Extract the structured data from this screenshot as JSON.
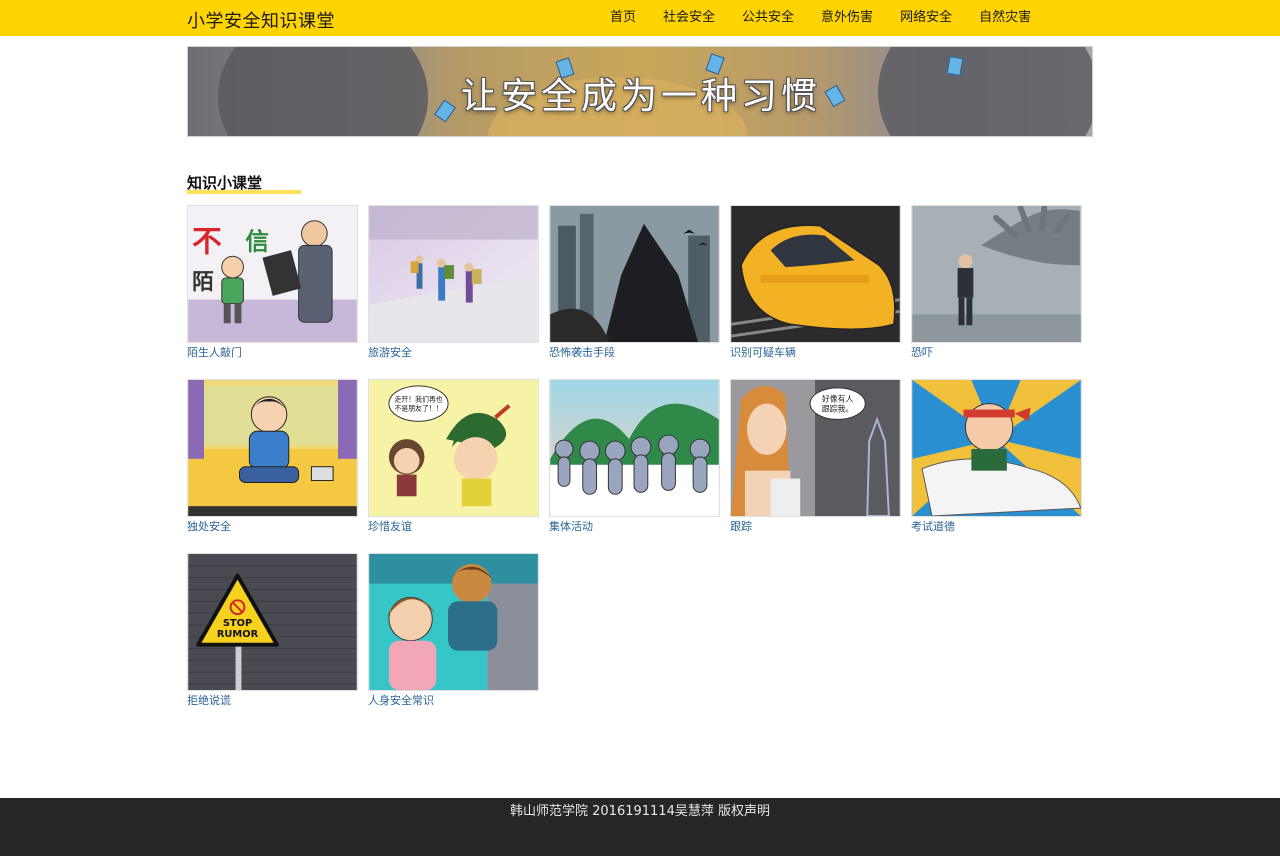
{
  "header": {
    "site_title": "小学安全知识课堂",
    "nav": [
      {
        "label": "首页"
      },
      {
        "label": "社会安全"
      },
      {
        "label": "公共安全"
      },
      {
        "label": "意外伤害"
      },
      {
        "label": "网络安全"
      },
      {
        "label": "自然灾害"
      }
    ]
  },
  "banner": {
    "slogan": "让安全成为一种习惯"
  },
  "section": {
    "title": "知识小课堂"
  },
  "items": [
    {
      "caption": "陌生人敲门"
    },
    {
      "caption": "旅游安全"
    },
    {
      "caption": "恐怖袭击手段"
    },
    {
      "caption": "识别可疑车辆"
    },
    {
      "caption": "恐吓"
    },
    {
      "caption": "独处安全"
    },
    {
      "caption": "珍惜友谊"
    },
    {
      "caption": "集体活动"
    },
    {
      "caption": "跟踪"
    },
    {
      "caption": "考试道德"
    },
    {
      "caption": "拒绝说谎"
    },
    {
      "caption": "人身安全常识"
    }
  ],
  "thumb_text": {
    "stranger": "不",
    "stranger_2": "信",
    "stranger_3": "陌",
    "friendship_bubble_line1": "走开！我们再也",
    "friendship_bubble_line2": "不是朋友了！！",
    "follow_bubble_line1": "好像有人",
    "follow_bubble_line2": "跟踪我。",
    "rumor_line1": "STOP",
    "rumor_line2": "RUMOR"
  },
  "footer": {
    "text": "韩山师范学院 2016191114吴慧萍 版权声明"
  }
}
